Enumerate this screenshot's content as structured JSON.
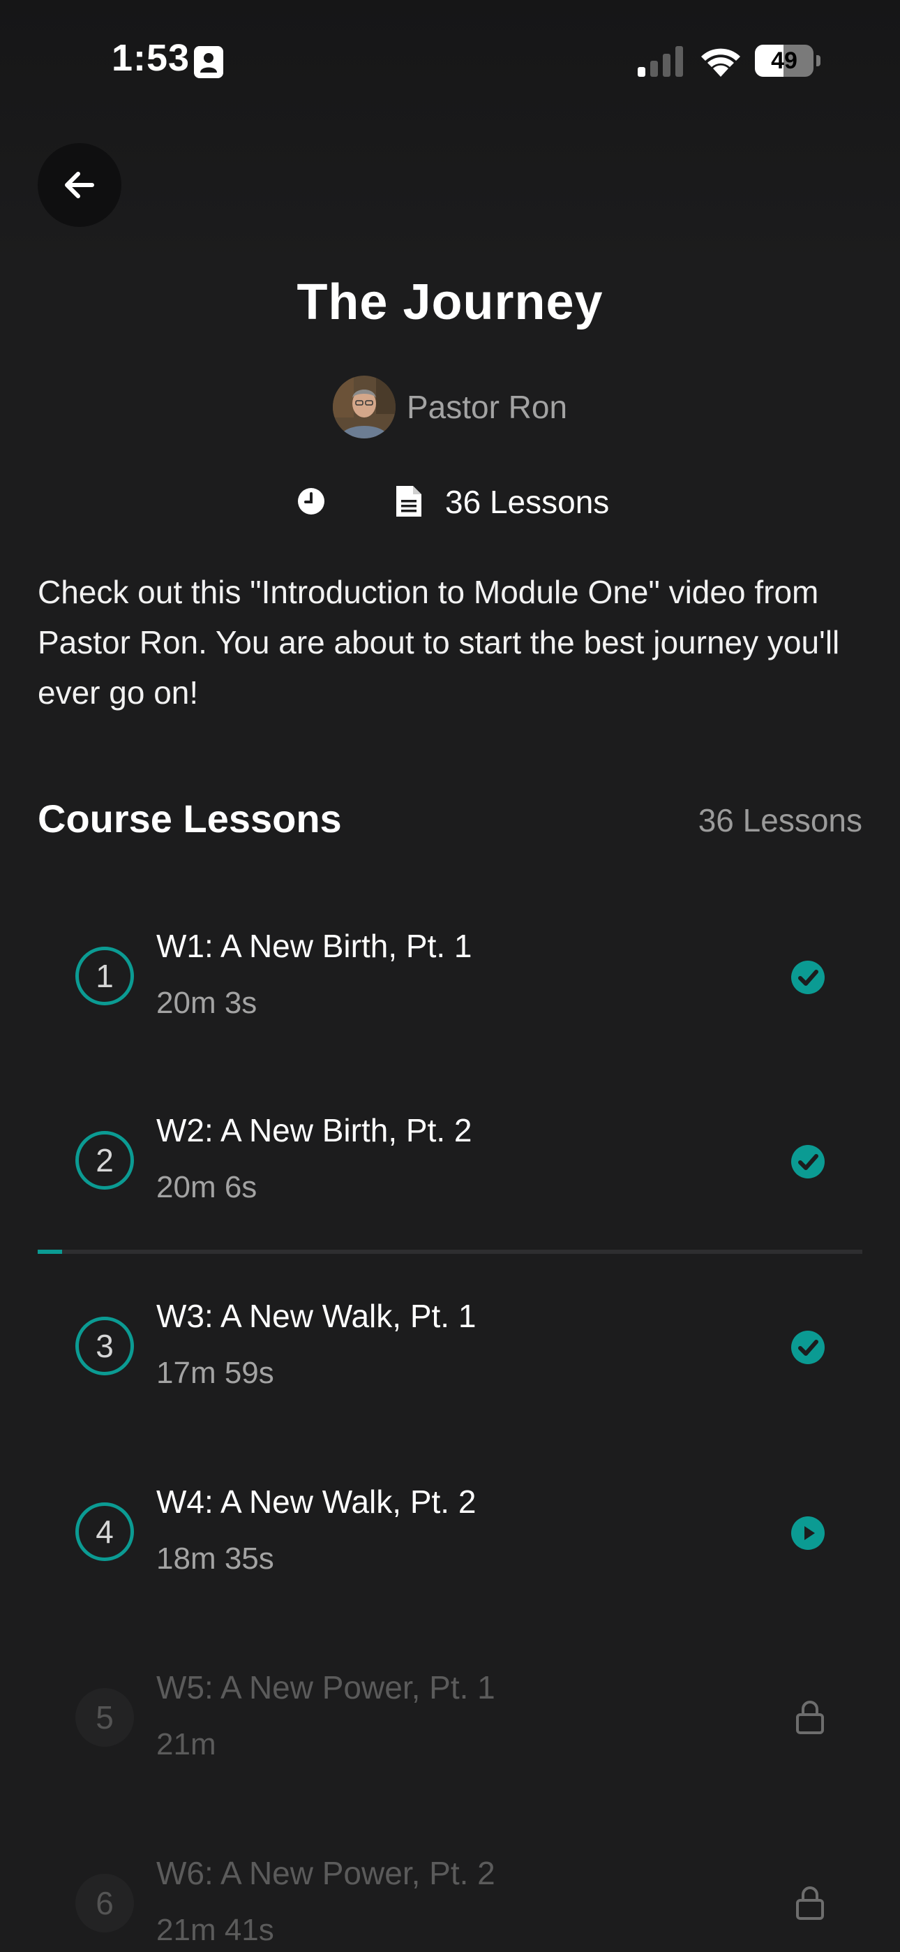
{
  "status_bar": {
    "time": "1:53",
    "battery_percent": 49,
    "battery_text": "49"
  },
  "course": {
    "title": "The Journey",
    "author": "Pastor Ron",
    "lessons_count_label": "36 Lessons",
    "description": "Check out this \"Introduction to Module One\" video from Pastor Ron. You are about to start the best journey you'll ever go on!"
  },
  "lessons_section": {
    "title": "Course Lessons",
    "count_label": "36 Lessons",
    "progress_fraction": 0.03
  },
  "lessons": [
    {
      "number": "1",
      "title": "W1: A New Birth, Pt. 1",
      "duration": "20m 3s",
      "status": "completed"
    },
    {
      "number": "2",
      "title": "W2: A New Birth, Pt. 2",
      "duration": "20m 6s",
      "status": "completed"
    },
    {
      "number": "3",
      "title": "W3: A New Walk, Pt. 1",
      "duration": "17m 59s",
      "status": "completed"
    },
    {
      "number": "4",
      "title": "W4: A New Walk, Pt. 2",
      "duration": "18m 35s",
      "status": "play"
    },
    {
      "number": "5",
      "title": "W5: A New Power, Pt. 1",
      "duration": "21m",
      "status": "locked"
    },
    {
      "number": "6",
      "title": "W6: A New Power, Pt. 2",
      "duration": "21m 41s",
      "status": "locked"
    }
  ],
  "colors": {
    "accent": "#0b9b93",
    "background": "#1c1c1d"
  },
  "icons": {
    "back": "arrow-left-icon",
    "clock": "clock-icon",
    "lessons": "document-icon",
    "completed": "check-circle-icon",
    "play": "play-circle-icon",
    "locked": "lock-icon"
  }
}
